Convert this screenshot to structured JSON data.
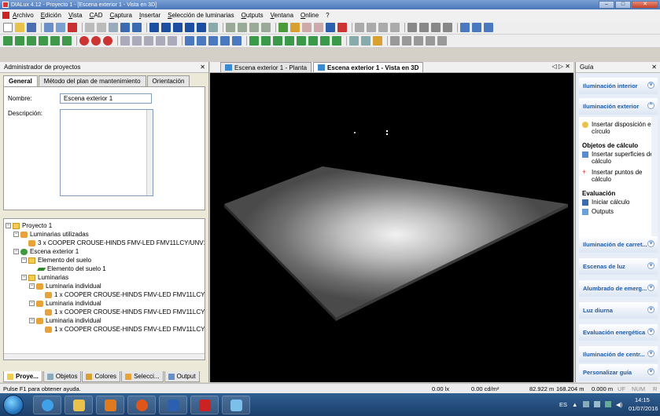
{
  "window": {
    "title": "DIALux 4.12 - Proyecto 1 - [Escena exterior 1 - Vista en 3D]",
    "controls": [
      "–",
      "□",
      "✕"
    ]
  },
  "menu": [
    "Archivo",
    "Edición",
    "Vista",
    "CAD",
    "Captura",
    "Insertar",
    "Selección de luminarias",
    "Outputs",
    "Ventana",
    "Online",
    "?"
  ],
  "project_manager": {
    "header": "Administrador de proyectos",
    "pin": "✕",
    "tabs": [
      "General",
      "Método del plan de mantenimiento",
      "Orientación"
    ],
    "name_label": "Nombre:",
    "name_value": "Escena exterior 1",
    "description_label": "Descripción:",
    "tree": [
      {
        "label": "Proyecto 1",
        "icon": "folder-icon"
      },
      {
        "label": "Luminarias utilizadas",
        "icon": "luminaire-icon"
      },
      {
        "label": "3 x COOPER CROUSE-HINDS FMV-LED FMV11LCY/UNV1",
        "icon": "luminaire-icon"
      },
      {
        "label": "Escena exterior 1",
        "icon": "scene-icon"
      },
      {
        "label": "Elemento del suelo",
        "icon": "folder-icon"
      },
      {
        "label": "Elemento del suelo 1",
        "icon": "floor-icon"
      },
      {
        "label": "Luminarias",
        "icon": "folder-icon"
      },
      {
        "label": "Luminaria individual",
        "icon": "luminaire-icon"
      },
      {
        "label": "1 x COOPER CROUSE-HINDS FMV-LED FMV11LCY/UNV",
        "icon": "luminaire-icon"
      },
      {
        "label": "Luminaria individual",
        "icon": "luminaire-icon"
      },
      {
        "label": "1 x COOPER CROUSE-HINDS FMV-LED FMV11LCY/UNV",
        "icon": "luminaire-icon"
      },
      {
        "label": "Luminaria individual",
        "icon": "luminaire-icon"
      },
      {
        "label": "1 x COOPER CROUSE-HINDS FMV-LED FMV11LCY/UNV",
        "icon": "luminaire-icon"
      }
    ],
    "bottom_tabs": [
      "Proye...",
      "Objetos",
      "Colores",
      "Selecci...",
      "Output"
    ]
  },
  "doc_tabs": {
    "tabs": [
      "Escena exterior 1 - Planta",
      "Escena exterior 1 - Vista en 3D"
    ],
    "active_index": 1,
    "controls": "◁ ▷ ✕"
  },
  "guide": {
    "header": "Guía",
    "pin": "✕",
    "sections_top": [
      "Iluminación interior",
      "Iluminación exterior"
    ],
    "items": [
      {
        "label": "Insertar disposición en círculo",
        "icon": "circle-layout-icon"
      }
    ],
    "calc_heading": "Objetos de cálculo",
    "calc_items": [
      {
        "label": "Insertar superficies de cálculo",
        "icon": "calc-surface-icon"
      },
      {
        "label": "Insertar puntos de cálculo",
        "icon": "calc-point-icon"
      }
    ],
    "eval_heading": "Evaluación",
    "eval_items": [
      {
        "label": "Iniciar cálculo",
        "icon": "start-calc-icon"
      },
      {
        "label": "Outputs",
        "icon": "outputs-icon"
      }
    ],
    "sections_bottom": [
      "Iluminación de carret...",
      "Escenas de luz",
      "Alumbrado de emerg...",
      "Luz diurna",
      "Evaluación energética",
      "Iluminación de centr...",
      "Personalizar guía"
    ]
  },
  "statusbar": {
    "help": "Pulse F1 para obtener ayuda.",
    "lux": "0.00 lx",
    "luminance": "0.00 cd/m²",
    "x": "82.922 m",
    "y": "168.204 m",
    "z": "0.000 m",
    "uf": "UF",
    "num": "NUM",
    "r": "R"
  },
  "taskbar": {
    "lang": "ES",
    "time": "14:15",
    "date": "01/07/2016"
  },
  "colors": {
    "guide_text": "#1f5aa8",
    "viewport_bg": "#000000"
  }
}
